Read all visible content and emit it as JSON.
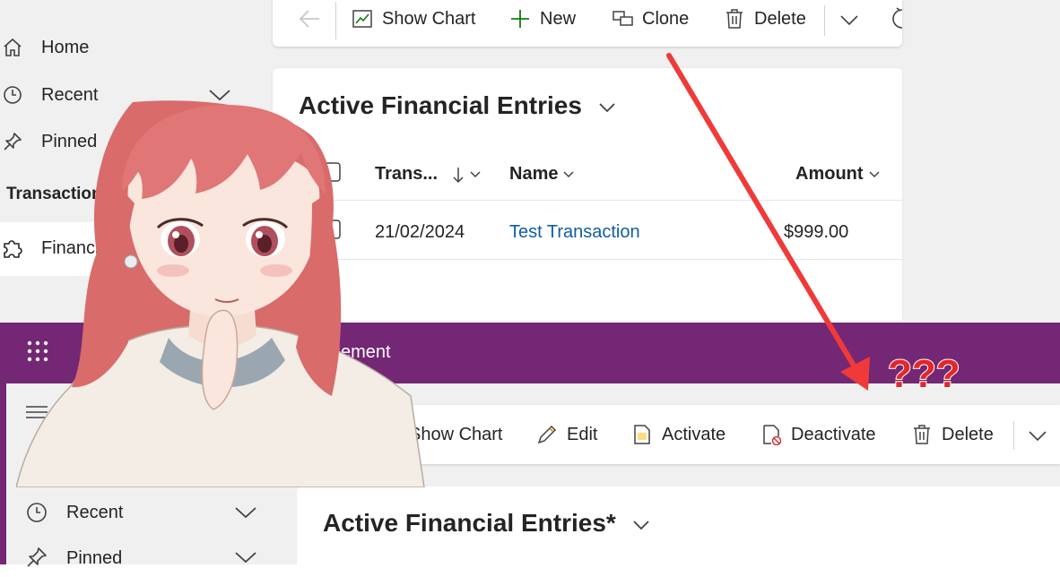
{
  "top_panel": {
    "sidebar": {
      "items": [
        {
          "label": "Home",
          "icon": "home-icon"
        },
        {
          "label": "Recent",
          "icon": "clock-icon"
        },
        {
          "label": "Pinned",
          "icon": "pin-icon"
        }
      ],
      "section_title": "Transactions",
      "entity_item": {
        "label": "Financial Entries",
        "icon": "puzzle-icon"
      }
    },
    "command_bar": {
      "show_chart": "Show Chart",
      "new": "New",
      "clone": "Clone",
      "delete": "Delete"
    },
    "grid": {
      "view_title": "Active Financial Entries",
      "columns": [
        "Trans...",
        "Name",
        "Amount"
      ],
      "rows": [
        {
          "date": "21/02/2024",
          "name": "Test Transaction",
          "amount": "$999.00"
        }
      ]
    }
  },
  "bottom_panel": {
    "header": {
      "app_name": "ement"
    },
    "command_bar": {
      "show_chart": "Show Chart",
      "edit": "Edit",
      "activate": "Activate",
      "deactivate": "Deactivate",
      "delete": "Delete"
    },
    "sidebar": {
      "items": [
        {
          "label": "Recent",
          "icon": "clock-icon"
        },
        {
          "label": "Pinned",
          "icon": "pin-icon"
        }
      ]
    },
    "grid": {
      "view_title": "Active Financial Entries*"
    }
  },
  "annotation": {
    "text": "???",
    "arrow_color": "#f03a3a"
  },
  "colors": {
    "header_purple": "#742774",
    "link_blue": "#115ea3",
    "new_plus_green": "#107c10",
    "panel_gray": "#f0f0f0"
  }
}
